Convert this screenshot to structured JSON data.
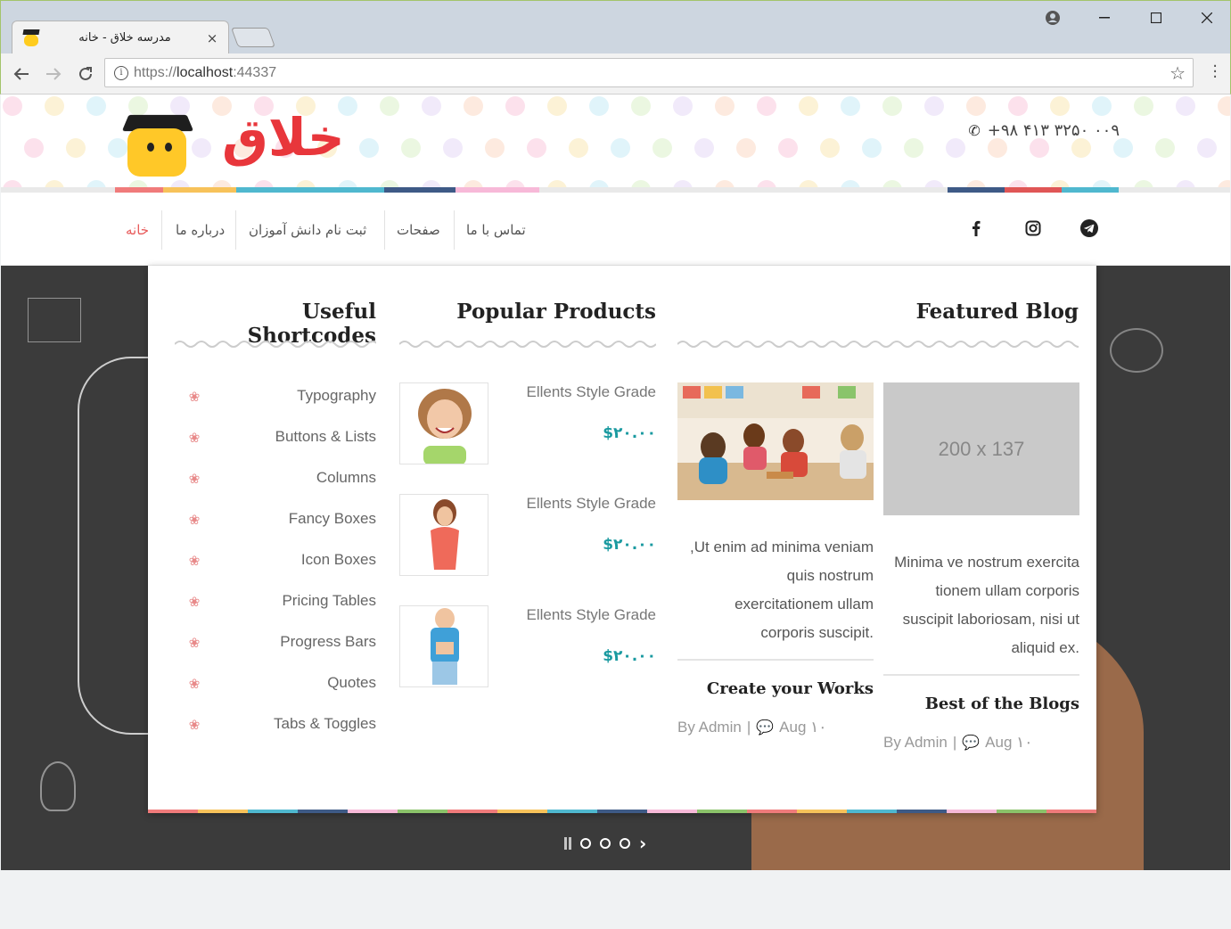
{
  "browser": {
    "tab_title": "مدرسه خلاق - خانه",
    "tab_close": "×",
    "url_scheme": "https://",
    "url_host": "localhost",
    "url_port": ":44337",
    "win_minimize": "—",
    "win_maximize": "☐",
    "win_close": "✕",
    "account_icon": "●"
  },
  "header": {
    "logo_text": "خلاق",
    "phone": "+۹۸ ۴۱۳ ۳۲۵۰ ۰۰۹"
  },
  "nav": {
    "items": [
      {
        "label": "خانه",
        "active": true
      },
      {
        "label": "درباره ما"
      },
      {
        "label": "ثبت نام دانش آموزان"
      },
      {
        "label": "صفحات"
      },
      {
        "label": "تماس با ما"
      }
    ],
    "social": [
      "facebook-icon",
      "instagram-icon",
      "telegram-icon"
    ],
    "active_color": "#e85a5a"
  },
  "mega": {
    "shortcodes": {
      "title": "Useful Shortcodes",
      "items": [
        "Typography",
        "Buttons & Lists",
        "Columns",
        "Fancy Boxes",
        "Icon Boxes",
        "Pricing Tables",
        "Progress Bars",
        "Quotes",
        "Tabs & Toggles"
      ]
    },
    "products": {
      "title": "Popular Products",
      "items": [
        {
          "name": "Ellents Style Grade",
          "price": "$۲۰.۰۰"
        },
        {
          "name": "Ellents Style Grade",
          "price": "$۲۰.۰۰"
        },
        {
          "name": "Ellents Style Grade",
          "price": "$۲۰.۰۰"
        }
      ]
    },
    "blog": {
      "title": "Featured Blog",
      "posts": [
        {
          "text": "Ut enim ad minima veniam, quis nostrum exercitationem ullam corporis suscipit.",
          "lines": [
            "Ut enim ad minima veniam,",
            "quis nostrum",
            "exercitationem ullam",
            ".corporis suscipit"
          ],
          "title": "Create your Works",
          "author": "By Admin",
          "sep": "|",
          "date": "Aug ۱۰"
        },
        {
          "placeholder": "200 x 137",
          "lines": [
            "Minima ve nostrum exercita",
            "tionem ullam corporis",
            "suscipit laboriosam, nisi ut",
            ".aliquid ex"
          ],
          "title": "Best of the Blogs",
          "author": "By Admin",
          "sep": "|",
          "date": "Aug ۱۰"
        }
      ]
    }
  },
  "colors": {
    "accent_red": "#e8363b",
    "price_teal": "#1a9aa0",
    "chalkboard": "#3b3b3b"
  }
}
